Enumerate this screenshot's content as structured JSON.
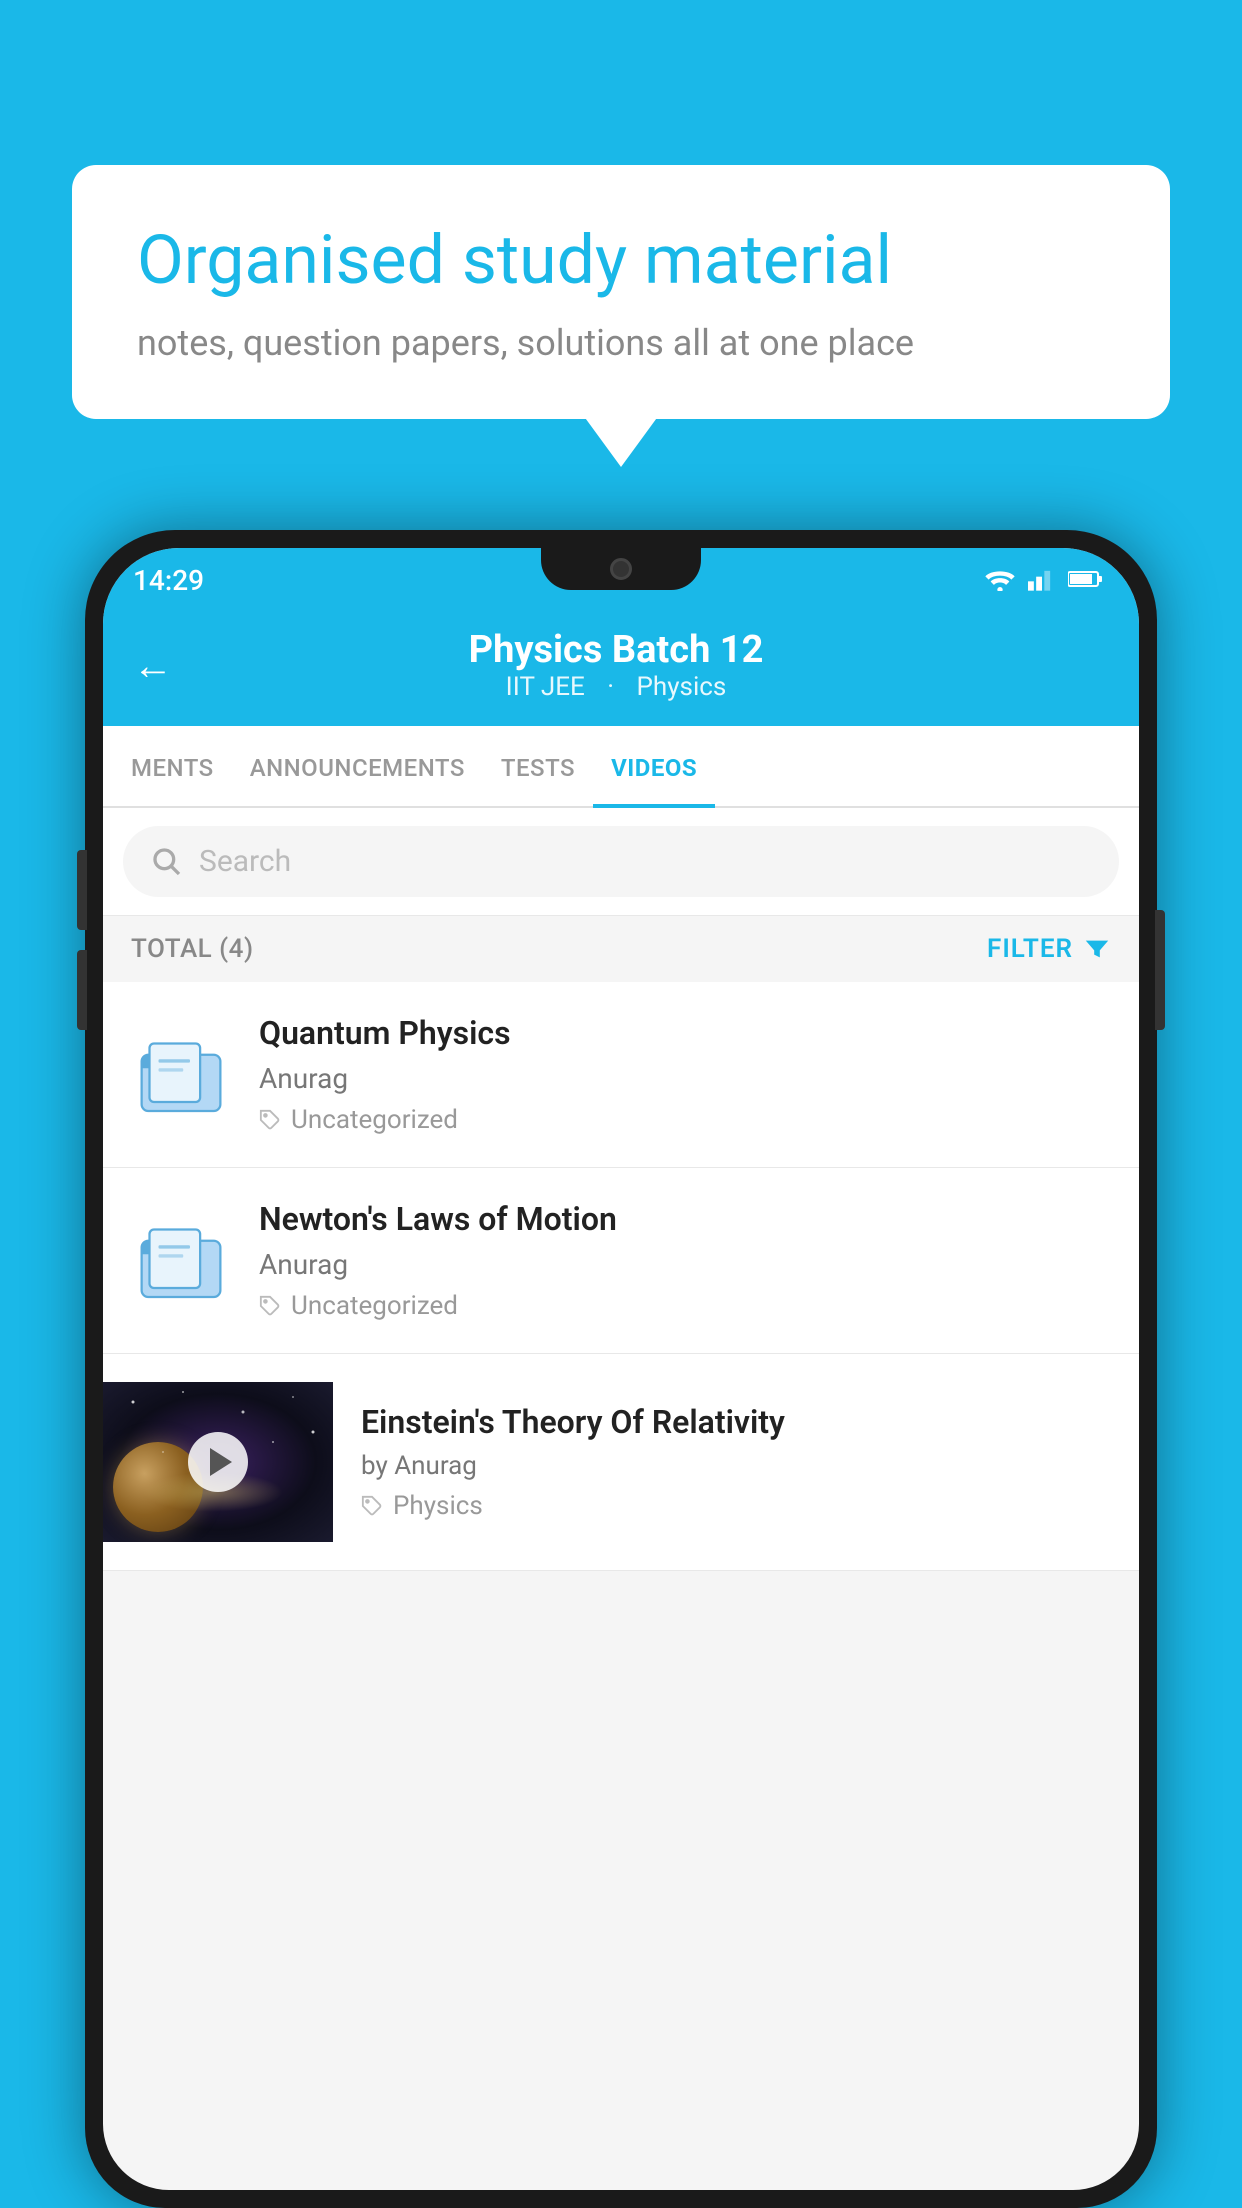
{
  "background_color": "#1ab8e8",
  "speech_bubble": {
    "title": "Organised study material",
    "subtitle": "notes, question papers, solutions all at one place"
  },
  "status_bar": {
    "time": "14:29",
    "wifi": "▾",
    "signal": "▲",
    "battery": "▓"
  },
  "header": {
    "back_label": "←",
    "title": "Physics Batch 12",
    "subtitle_part1": "IIT JEE",
    "subtitle_part2": "Physics"
  },
  "tabs": [
    {
      "label": "MENTS",
      "active": false
    },
    {
      "label": "ANNOUNCEMENTS",
      "active": false
    },
    {
      "label": "TESTS",
      "active": false
    },
    {
      "label": "VIDEOS",
      "active": true
    }
  ],
  "search": {
    "placeholder": "Search"
  },
  "filter_row": {
    "total_label": "TOTAL (4)",
    "filter_label": "FILTER"
  },
  "video_items": [
    {
      "id": "quantum",
      "title": "Quantum Physics",
      "author": "Anurag",
      "tag": "Uncategorized",
      "has_thumbnail": false
    },
    {
      "id": "newton",
      "title": "Newton's Laws of Motion",
      "author": "Anurag",
      "tag": "Uncategorized",
      "has_thumbnail": false
    },
    {
      "id": "einstein",
      "title": "Einstein's Theory Of Relativity",
      "author": "by Anurag",
      "tag": "Physics",
      "has_thumbnail": true
    }
  ]
}
